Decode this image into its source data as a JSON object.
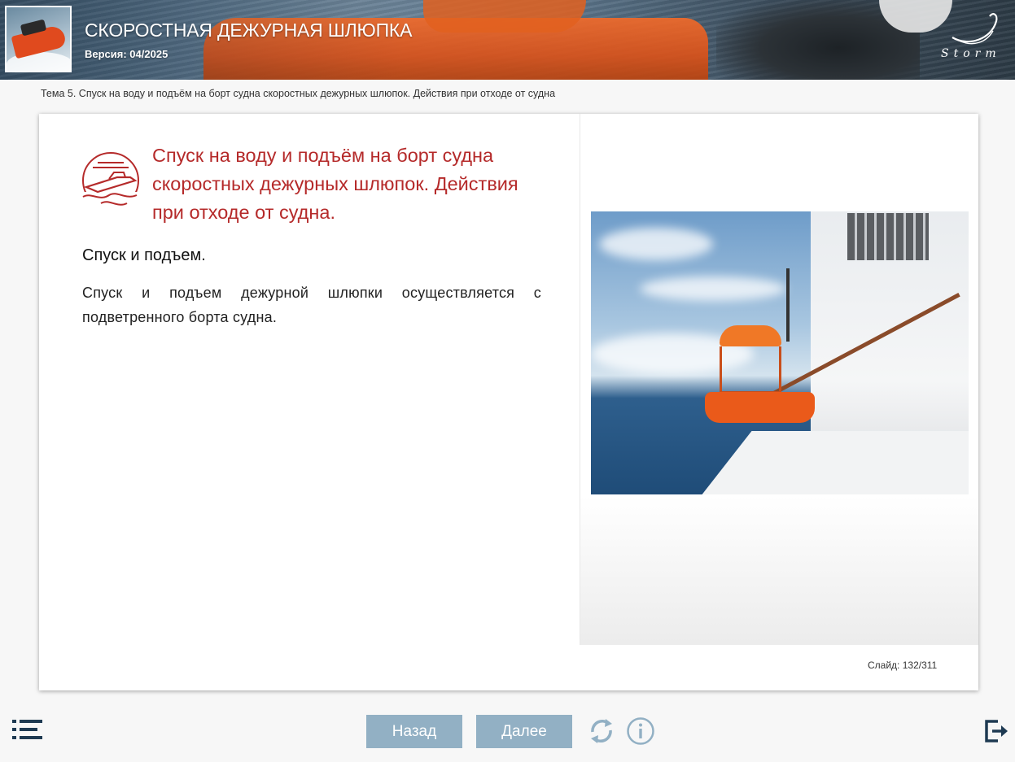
{
  "header": {
    "title": "СКОРОСТНАЯ ДЕЖУРНАЯ ШЛЮПКА",
    "version": "Версия: 04/2025",
    "logo_text": "Storm"
  },
  "breadcrumb": "Тема 5. Спуск на воду и подъём на борт судна скоростных дежурных шлюпок. Действия при отходе от судна",
  "slide": {
    "topic_title": "Спуск на воду и подъём на борт судна скоростных дежурных шлюпок. Действия при отходе от судна.",
    "section_title": "Спуск и подъем.",
    "body": "Спуск и подъем дежурной шлюпки осуществляется с подветренного борта судна.",
    "counter": "Слайд:  132/311"
  },
  "navigation": {
    "back_label": "Назад",
    "next_label": "Далее"
  },
  "icons": {
    "menu": "list-menu-icon",
    "reload": "reload-icon",
    "info": "info-icon",
    "exit": "exit-icon",
    "topic": "speedboat-icon"
  },
  "colors": {
    "title_red": "#b52a2a",
    "nav_button": "#92b0c4",
    "icon_dark": "#1e3a52"
  }
}
